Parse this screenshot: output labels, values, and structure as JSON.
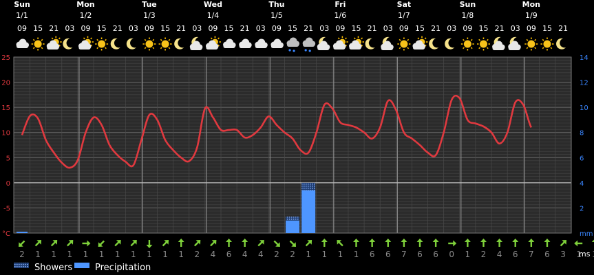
{
  "chart_data": {
    "type": "line",
    "title": "",
    "days": [
      {
        "name": "Sun",
        "date": "1/1",
        "start": 0
      },
      {
        "name": "Mon",
        "date": "1/2",
        "start": 4
      },
      {
        "name": "Tue",
        "date": "1/3",
        "start": 8
      },
      {
        "name": "Wed",
        "date": "1/4",
        "start": 12
      },
      {
        "name": "Thu",
        "date": "1/5",
        "start": 16
      },
      {
        "name": "Fri",
        "date": "1/6",
        "start": 20
      },
      {
        "name": "Sat",
        "date": "1/7",
        "start": 24
      },
      {
        "name": "Sun",
        "date": "1/8",
        "start": 28
      },
      {
        "name": "Mon",
        "date": "1/9",
        "start": 32
      }
    ],
    "hours": [
      "09",
      "15",
      "21",
      "03",
      "09",
      "15",
      "21",
      "03",
      "09",
      "15",
      "21",
      "03",
      "09",
      "15",
      "21",
      "03",
      "09",
      "15",
      "21",
      "03",
      "09",
      "15",
      "21",
      "03",
      "09",
      "15",
      "21",
      "03",
      "09",
      "15",
      "21",
      "03",
      "09",
      "15",
      "21"
    ],
    "icons": [
      "cloud",
      "sun",
      "sun-cloud",
      "moon",
      "sun-cloud",
      "sun",
      "moon",
      "moon",
      "sun",
      "sun",
      "moon",
      "moon-cloud",
      "sun-cloud",
      "cloud",
      "cloud",
      "cloud",
      "cloud",
      "shower",
      "rain-cloud",
      "moon-cloud",
      "sun-cloud",
      "sun-cloud",
      "moon",
      "moon-cloud",
      "sun",
      "sun-cloud",
      "moon",
      "moon",
      "sun",
      "sun",
      "moon-cloud",
      "moon-cloud",
      "sun",
      "sun",
      "moon"
    ],
    "temperature_series": {
      "name": "",
      "color": "#e0393f",
      "x": [
        0,
        0.5,
        1,
        1.5,
        2,
        2.5,
        3,
        3.5,
        4,
        4.5,
        5,
        5.5,
        6,
        6.5,
        7,
        7.5,
        8,
        8.5,
        9,
        9.5,
        10,
        10.5,
        11,
        11.5,
        12,
        12.5,
        13,
        13.5,
        14,
        14.5,
        15,
        15.5,
        16,
        16.5,
        17,
        17.5,
        18,
        18.5,
        19,
        19.5,
        20,
        20.5,
        21,
        21.5,
        22,
        22.5,
        23,
        23.5,
        24,
        24.5,
        25,
        25.5,
        26,
        26.5,
        27,
        27.5,
        28,
        28.5,
        29,
        29.5,
        30,
        30.5,
        31,
        31.5,
        32,
        32.5,
        33,
        33.5,
        34,
        34.5,
        35
      ],
      "values": [
        9.5,
        13.3,
        12.8,
        8.5,
        6.0,
        4.0,
        3.0,
        4.5,
        10.0,
        13.0,
        11.5,
        7.5,
        5.5,
        4.2,
        3.5,
        8.5,
        13.5,
        12.5,
        8.5,
        6.5,
        5.0,
        4.3,
        7.0,
        14.8,
        13.0,
        10.5,
        10.5,
        10.5,
        9.0,
        9.5,
        11.0,
        13.2,
        11.5,
        10.0,
        8.8,
        6.5,
        6.0,
        10.0,
        15.5,
        14.8,
        12.0,
        11.5,
        11.0,
        10.0,
        8.8,
        11.0,
        16.3,
        14.5,
        10.0,
        8.8,
        7.5,
        6.0,
        5.5,
        10.0,
        16.5,
        16.8,
        12.5,
        11.8,
        11.2,
        10.0,
        7.8,
        10.0,
        16.0,
        15.5,
        11.0,
        10.0
      ]
    },
    "precipitation": [
      {
        "x": 17,
        "value": 1.3,
        "showers": 0.3
      },
      {
        "x": 18,
        "value": 4.0,
        "showers": 0.6
      }
    ],
    "wind": {
      "speeds": [
        2,
        1,
        1,
        1,
        1,
        1,
        1,
        1,
        1,
        1,
        1,
        2,
        4,
        6,
        4,
        4,
        2,
        2,
        1,
        1,
        1,
        1,
        6,
        6,
        7,
        6,
        6,
        0,
        1,
        2,
        4,
        6,
        7,
        6,
        3,
        1,
        3
      ],
      "dirs": [
        225,
        45,
        45,
        45,
        90,
        225,
        45,
        45,
        180,
        45,
        0,
        45,
        45,
        0,
        0,
        45,
        135,
        135,
        45,
        0,
        315,
        0,
        0,
        0,
        0,
        0,
        0,
        90,
        0,
        0,
        0,
        0,
        0,
        0,
        45,
        270,
        0
      ]
    },
    "y_left": {
      "min": -10,
      "max": 25,
      "ticks": [
        25,
        20,
        15,
        10,
        5,
        0,
        -5,
        -10
      ],
      "labels": [
        "25",
        "20",
        "15",
        "10",
        "5",
        "0",
        "-5",
        "°C"
      ],
      "unit": "°C"
    },
    "y_right": {
      "min": 0,
      "max": 14,
      "ticks": [
        14,
        12,
        10,
        8,
        6,
        4,
        2,
        0
      ],
      "labels": [
        "14",
        "12",
        "10",
        "8",
        "6",
        "4",
        "2",
        "mm"
      ],
      "unit": "mm"
    },
    "wind_unit": "ms",
    "grid": true,
    "legend": {
      "placement": "bottom-left",
      "items": [
        {
          "name": "Showers",
          "pattern": "dotted",
          "color": "#7da7ff"
        },
        {
          "name": "Precipitation",
          "color": "#4e96ff"
        }
      ]
    }
  }
}
